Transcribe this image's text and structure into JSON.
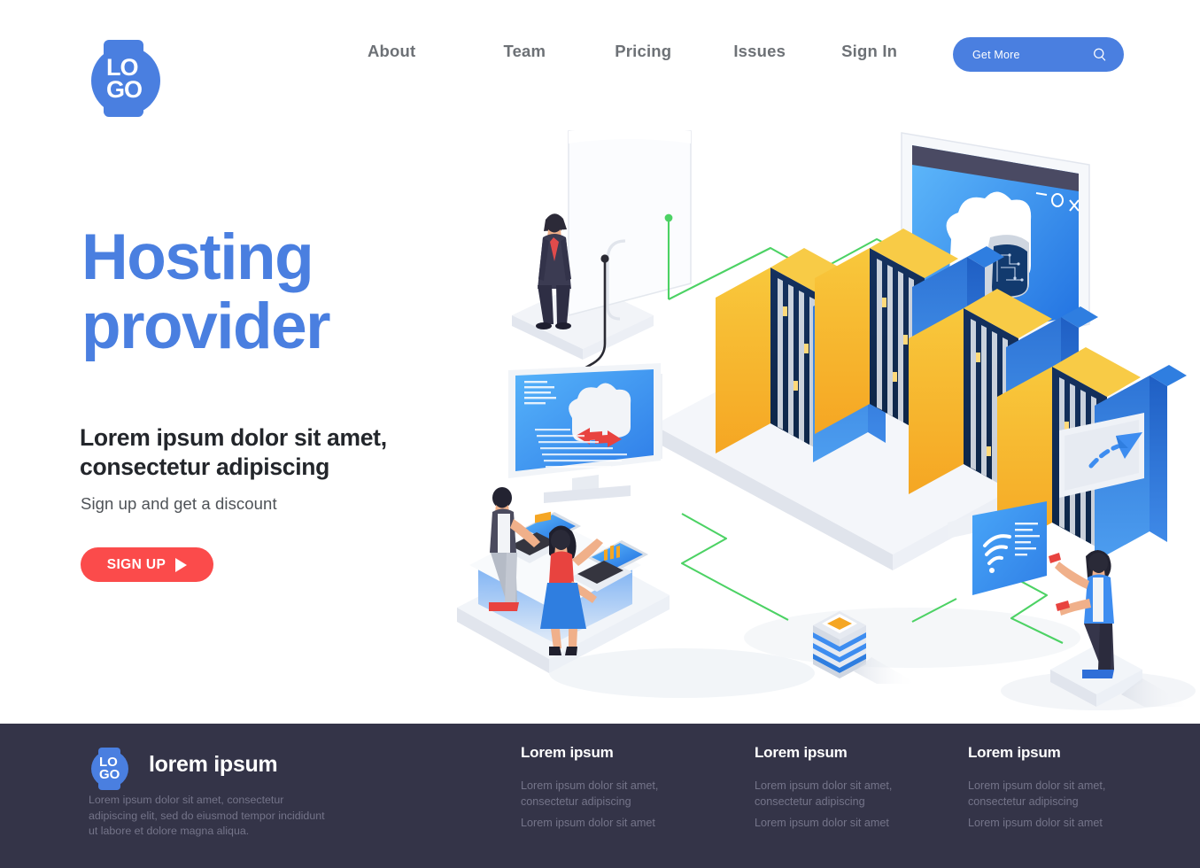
{
  "brand": {
    "logo_line1": "LO",
    "logo_line2": "GO",
    "accent_color": "#4a7fe0",
    "cta_color": "#fb4b4b",
    "footer_bg": "#343448"
  },
  "nav": {
    "items": [
      {
        "label": "About"
      },
      {
        "label": "Team"
      },
      {
        "label": "Pricing"
      },
      {
        "label": "Issues"
      },
      {
        "label": "Sign In"
      }
    ],
    "cta": {
      "label": "Get More",
      "icon": "search-icon"
    }
  },
  "hero": {
    "title_line1": "Hosting",
    "title_line2": "provider",
    "subtitle_line1": "Lorem ipsum dolor sit amet,",
    "subtitle_line2": "consectetur adipiscing",
    "note": "Sign up and get a discount",
    "button": {
      "label": "SIGN UP",
      "icon": "play-triangle-icon"
    }
  },
  "illustration": {
    "name": "isometric-hosting-datacenter",
    "window_controls": "— O X",
    "elements": [
      "server-racks",
      "cloud-monitor",
      "cloud-transfer-screen",
      "wifi-panel",
      "cursor-card",
      "data-stack",
      "businessman-figure",
      "desk-workers-figures",
      "standing-person-figure"
    ]
  },
  "footer": {
    "logo_line1": "LO",
    "logo_line2": "GO",
    "brand": "lorem ipsum",
    "description": "Lorem ipsum dolor sit amet, consectetur adipiscing elit, sed do eiusmod tempor incididunt ut labore et dolore magna aliqua.",
    "columns": [
      {
        "title": "Lorem ipsum",
        "link1": "Lorem ipsum dolor sit amet, consectetur adipiscing",
        "link2": "Lorem ipsum dolor sit amet"
      },
      {
        "title": "Lorem ipsum",
        "link1": "Lorem ipsum dolor sit amet, consectetur adipiscing",
        "link2": "Lorem ipsum dolor sit amet"
      },
      {
        "title": "Lorem ipsum",
        "link1": "Lorem ipsum dolor sit amet, consectetur adipiscing",
        "link2": "Lorem ipsum dolor sit amet"
      }
    ]
  }
}
